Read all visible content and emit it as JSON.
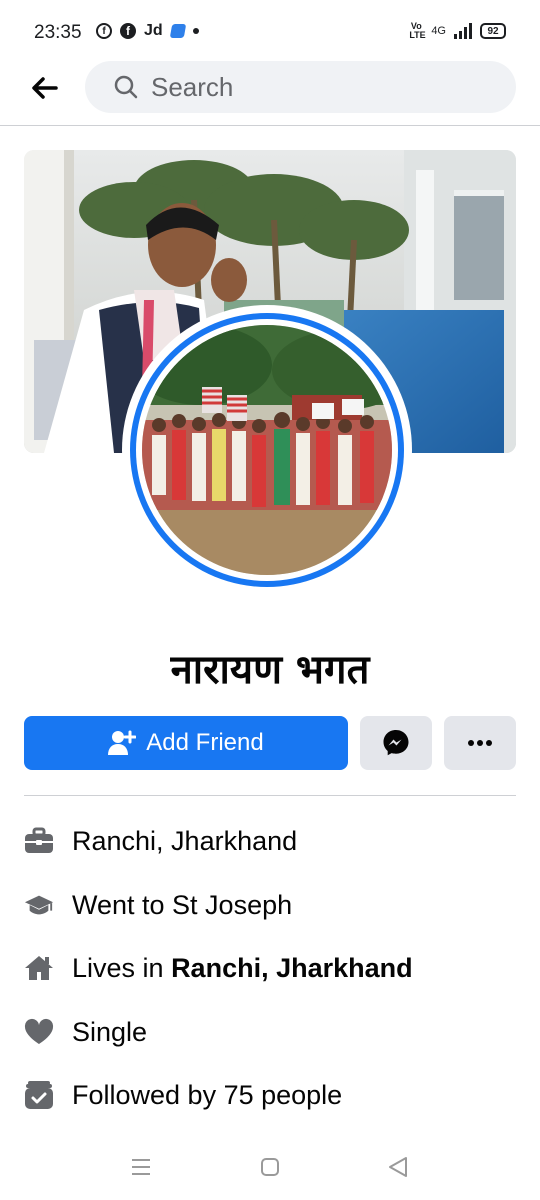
{
  "status_bar": {
    "time": "23:35",
    "app_label": "Jd",
    "network": "4G",
    "volte": "Vo LTE",
    "battery": "92"
  },
  "header": {
    "search_placeholder": "Search"
  },
  "profile": {
    "name": "नारायण भगत",
    "add_friend_label": "Add Friend"
  },
  "details": [
    {
      "icon": "briefcase-icon",
      "text": "Ranchi, Jharkhand",
      "bold": ""
    },
    {
      "icon": "graduation-cap-icon",
      "text": "Went to St Joseph",
      "bold": ""
    },
    {
      "icon": "home-icon",
      "text": "Lives in ",
      "bold": "Ranchi, Jharkhand"
    },
    {
      "icon": "heart-icon",
      "text": "Single",
      "bold": ""
    },
    {
      "icon": "followers-icon",
      "text": "Followed by 75 people",
      "bold": ""
    }
  ],
  "colors": {
    "accent": "#1877f2",
    "button_gray": "#e4e6eb",
    "search_bg": "#f0f2f5",
    "icon_gray": "#65676b"
  }
}
